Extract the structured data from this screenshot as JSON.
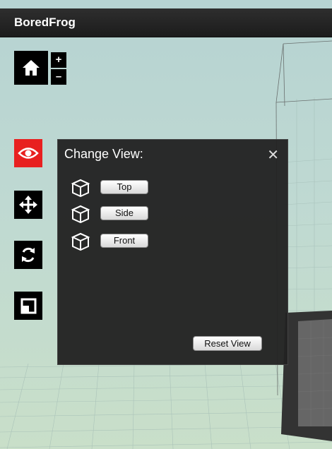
{
  "app": {
    "title": "BoredFrog"
  },
  "toolbar": {
    "home_icon": "home-icon",
    "zoom_in_label": "+",
    "zoom_out_label": "–",
    "tools": [
      {
        "name": "view",
        "icon": "eye-icon",
        "active": true
      },
      {
        "name": "move",
        "icon": "move-arrows-icon",
        "active": false
      },
      {
        "name": "rotate",
        "icon": "rotate-icon",
        "active": false
      },
      {
        "name": "scale",
        "icon": "scale-icon",
        "active": false
      }
    ],
    "active_color": "#e82020"
  },
  "panel": {
    "title": "Change View:",
    "close_label": "✕",
    "views": [
      {
        "label": "Top",
        "icon": "cube-icon"
      },
      {
        "label": "Side",
        "icon": "cube-icon"
      },
      {
        "label": "Front",
        "icon": "cube-icon"
      }
    ],
    "reset_label": "Reset View"
  }
}
